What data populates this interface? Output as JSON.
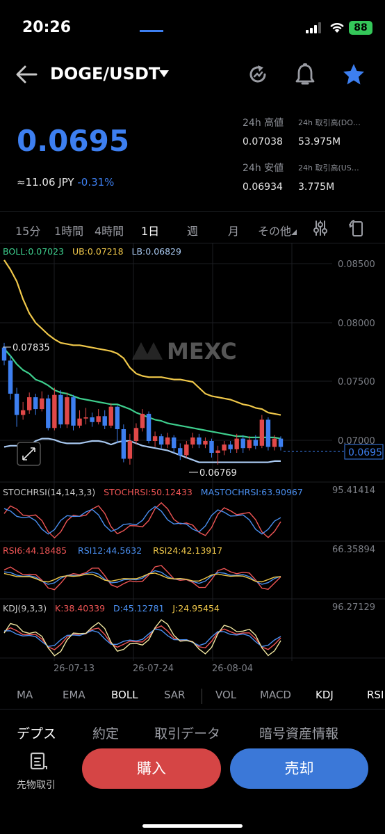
{
  "status_bar": {
    "time": "20:26",
    "battery": "88"
  },
  "header": {
    "pair": "DOGE/USDT"
  },
  "price": {
    "last": "0.0695",
    "jpy": "≈11.06 JPY",
    "change": "-0.31%",
    "high_label": "24h 高値",
    "high": "0.07038",
    "low_label": "24h 安値",
    "low": "0.06934",
    "vol_base_label": "24h 取引高(DO…",
    "vol_base": "53.975M",
    "vol_quote_label": "24h 取引高(US…",
    "vol_quote": "3.775M"
  },
  "intervals": [
    "15分",
    "1時間",
    "4時間",
    "1日",
    "週",
    "月",
    "その他"
  ],
  "active_interval": "1日",
  "indicators": {
    "boll": "BOLL:0.07023",
    "ub": "UB:0.07218",
    "lb": "LB:0.06829",
    "stoch": "STOCHRSI(14,14,3,3)",
    "stoch_val": "STOCHRSI:50.12433",
    "mastoch_val": "MASTOCHRSI:63.90967",
    "stoch_max": "95.41414",
    "rsi6": "RSI6:44.18485",
    "rsi12": "RSI12:44.5632",
    "rsi24": "RSI24:42.13917",
    "rsi_max": "66.35894",
    "kdj": "KDJ(9,3,3)",
    "kdj_k": "K:38.40339",
    "kdj_d": "D:45.12781",
    "kdj_j": "J:24.95454",
    "kdj_max": "96.27129"
  },
  "watermark": "MEXC",
  "chart_data": {
    "type": "candlestick",
    "y_axis_ticks": [
      "0.08500",
      "0.08000",
      "0.07500",
      "0.07000"
    ],
    "current_price_tag": "0.0695",
    "max_label": "0.07835",
    "min_label": "0.06769",
    "x_axis_labels": [
      "26-07-13",
      "26-07-24",
      "26-08-04"
    ],
    "candles": [
      {
        "o": 0.0779,
        "c": 0.0768,
        "h": 0.0783,
        "l": 0.0764
      },
      {
        "o": 0.0768,
        "c": 0.074,
        "h": 0.0772,
        "l": 0.0735
      },
      {
        "o": 0.074,
        "c": 0.0722,
        "h": 0.0745,
        "l": 0.0712
      },
      {
        "o": 0.0722,
        "c": 0.0726,
        "h": 0.0733,
        "l": 0.0718
      },
      {
        "o": 0.0726,
        "c": 0.0737,
        "h": 0.0741,
        "l": 0.0723
      },
      {
        "o": 0.0737,
        "c": 0.0727,
        "h": 0.074,
        "l": 0.0722
      },
      {
        "o": 0.0727,
        "c": 0.0736,
        "h": 0.0742,
        "l": 0.0725
      },
      {
        "o": 0.0736,
        "c": 0.0711,
        "h": 0.0739,
        "l": 0.0709
      },
      {
        "o": 0.0711,
        "c": 0.0739,
        "h": 0.0745,
        "l": 0.0709
      },
      {
        "o": 0.0739,
        "c": 0.0714,
        "h": 0.0743,
        "l": 0.0711
      },
      {
        "o": 0.0714,
        "c": 0.0737,
        "h": 0.0741,
        "l": 0.0711
      },
      {
        "o": 0.0737,
        "c": 0.0713,
        "h": 0.0739,
        "l": 0.0709
      },
      {
        "o": 0.0713,
        "c": 0.0719,
        "h": 0.0726,
        "l": 0.0711
      },
      {
        "o": 0.0719,
        "c": 0.072,
        "h": 0.0728,
        "l": 0.0714
      },
      {
        "o": 0.072,
        "c": 0.0716,
        "h": 0.0724,
        "l": 0.0712
      },
      {
        "o": 0.0716,
        "c": 0.0721,
        "h": 0.0727,
        "l": 0.0714
      },
      {
        "o": 0.0721,
        "c": 0.0713,
        "h": 0.0726,
        "l": 0.071
      },
      {
        "o": 0.0713,
        "c": 0.0729,
        "h": 0.0732,
        "l": 0.0711
      },
      {
        "o": 0.0729,
        "c": 0.071,
        "h": 0.073,
        "l": 0.0698
      },
      {
        "o": 0.071,
        "c": 0.0685,
        "h": 0.0714,
        "l": 0.0682
      },
      {
        "o": 0.0685,
        "c": 0.07,
        "h": 0.0706,
        "l": 0.068
      },
      {
        "o": 0.07,
        "c": 0.0711,
        "h": 0.0715,
        "l": 0.0697
      },
      {
        "o": 0.0711,
        "c": 0.0723,
        "h": 0.0727,
        "l": 0.0708
      },
      {
        "o": 0.0723,
        "c": 0.07,
        "h": 0.0725,
        "l": 0.0698
      },
      {
        "o": 0.07,
        "c": 0.0704,
        "h": 0.0708,
        "l": 0.0695
      },
      {
        "o": 0.0704,
        "c": 0.0697,
        "h": 0.0706,
        "l": 0.0693
      },
      {
        "o": 0.0697,
        "c": 0.0703,
        "h": 0.0707,
        "l": 0.0694
      },
      {
        "o": 0.0703,
        "c": 0.0694,
        "h": 0.0705,
        "l": 0.069
      },
      {
        "o": 0.0694,
        "c": 0.0688,
        "h": 0.0698,
        "l": 0.0684
      },
      {
        "o": 0.0688,
        "c": 0.0697,
        "h": 0.07,
        "l": 0.0686
      },
      {
        "o": 0.0697,
        "c": 0.0703,
        "h": 0.0707,
        "l": 0.0694
      },
      {
        "o": 0.0703,
        "c": 0.0697,
        "h": 0.0706,
        "l": 0.0694
      },
      {
        "o": 0.0697,
        "c": 0.07,
        "h": 0.0703,
        "l": 0.0694
      },
      {
        "o": 0.07,
        "c": 0.069,
        "h": 0.0702,
        "l": 0.0686
      },
      {
        "o": 0.069,
        "c": 0.0692,
        "h": 0.0696,
        "l": 0.068
      },
      {
        "o": 0.0692,
        "c": 0.0697,
        "h": 0.07,
        "l": 0.0688
      },
      {
        "o": 0.0697,
        "c": 0.0693,
        "h": 0.07,
        "l": 0.069
      },
      {
        "o": 0.0693,
        "c": 0.0702,
        "h": 0.0706,
        "l": 0.069
      },
      {
        "o": 0.0702,
        "c": 0.0694,
        "h": 0.0705,
        "l": 0.069
      },
      {
        "o": 0.0694,
        "c": 0.0701,
        "h": 0.0704,
        "l": 0.0692
      },
      {
        "o": 0.0701,
        "c": 0.0696,
        "h": 0.0705,
        "l": 0.0693
      },
      {
        "o": 0.0696,
        "c": 0.0718,
        "h": 0.0722,
        "l": 0.0694
      },
      {
        "o": 0.0718,
        "c": 0.0695,
        "h": 0.072,
        "l": 0.0692
      },
      {
        "o": 0.0695,
        "c": 0.0702,
        "h": 0.0705,
        "l": 0.0692
      },
      {
        "o": 0.0702,
        "c": 0.0695,
        "h": 0.0704,
        "l": 0.0692
      }
    ],
    "boll_mid": [
      0.0778,
      0.0772,
      0.0765,
      0.076,
      0.0757,
      0.0752,
      0.075,
      0.0747,
      0.0743,
      0.0741,
      0.074,
      0.0738,
      0.0736,
      0.0735,
      0.0734,
      0.0733,
      0.0732,
      0.0731,
      0.0731,
      0.0729,
      0.0727,
      0.0724,
      0.0722,
      0.072,
      0.0718,
      0.0717,
      0.0715,
      0.0714,
      0.0713,
      0.0712,
      0.0711,
      0.071,
      0.0709,
      0.0708,
      0.0707,
      0.0706,
      0.0705,
      0.0704,
      0.0704,
      0.0703,
      0.0703,
      0.0703,
      0.0703,
      0.0703,
      0.0702
    ],
    "boll_upper": [
      0.0853,
      0.0845,
      0.0835,
      0.082,
      0.0808,
      0.08,
      0.0795,
      0.079,
      0.0786,
      0.0783,
      0.0782,
      0.0781,
      0.0781,
      0.078,
      0.0779,
      0.0778,
      0.0777,
      0.0776,
      0.0774,
      0.077,
      0.0762,
      0.0757,
      0.0755,
      0.0754,
      0.0754,
      0.0754,
      0.0753,
      0.0752,
      0.0752,
      0.0751,
      0.075,
      0.0745,
      0.074,
      0.0738,
      0.0737,
      0.0736,
      0.0735,
      0.0733,
      0.0731,
      0.073,
      0.0728,
      0.0727,
      0.0724,
      0.0723,
      0.0722
    ],
    "boll_lower": [
      0.0695,
      0.0696,
      0.0696,
      0.0694,
      0.0696,
      0.07,
      0.0702,
      0.0702,
      0.0701,
      0.0699,
      0.0698,
      0.0698,
      0.0698,
      0.0699,
      0.07,
      0.07,
      0.0699,
      0.0697,
      0.0699,
      0.07,
      0.07,
      0.0698,
      0.0696,
      0.0695,
      0.0694,
      0.0693,
      0.0692,
      0.069,
      0.0688,
      0.0686,
      0.0684,
      0.0682,
      0.0682,
      0.0682,
      0.0682,
      0.0682,
      0.0682,
      0.0682,
      0.0682,
      0.0682,
      0.0682,
      0.0682,
      0.0682,
      0.0683,
      0.0683
    ],
    "ylim": [
      0.0685,
      0.0865
    ]
  },
  "indicator_tabs": [
    "MA",
    "EMA",
    "BOLL",
    "SAR",
    "VOL",
    "MACD",
    "KDJ",
    "RSI"
  ],
  "bottom_tabs": [
    "デプス",
    "約定",
    "取引データ",
    "暗号資産情報"
  ],
  "futures_label": "先物取引",
  "buy_label": "購入",
  "sell_label": "売却"
}
